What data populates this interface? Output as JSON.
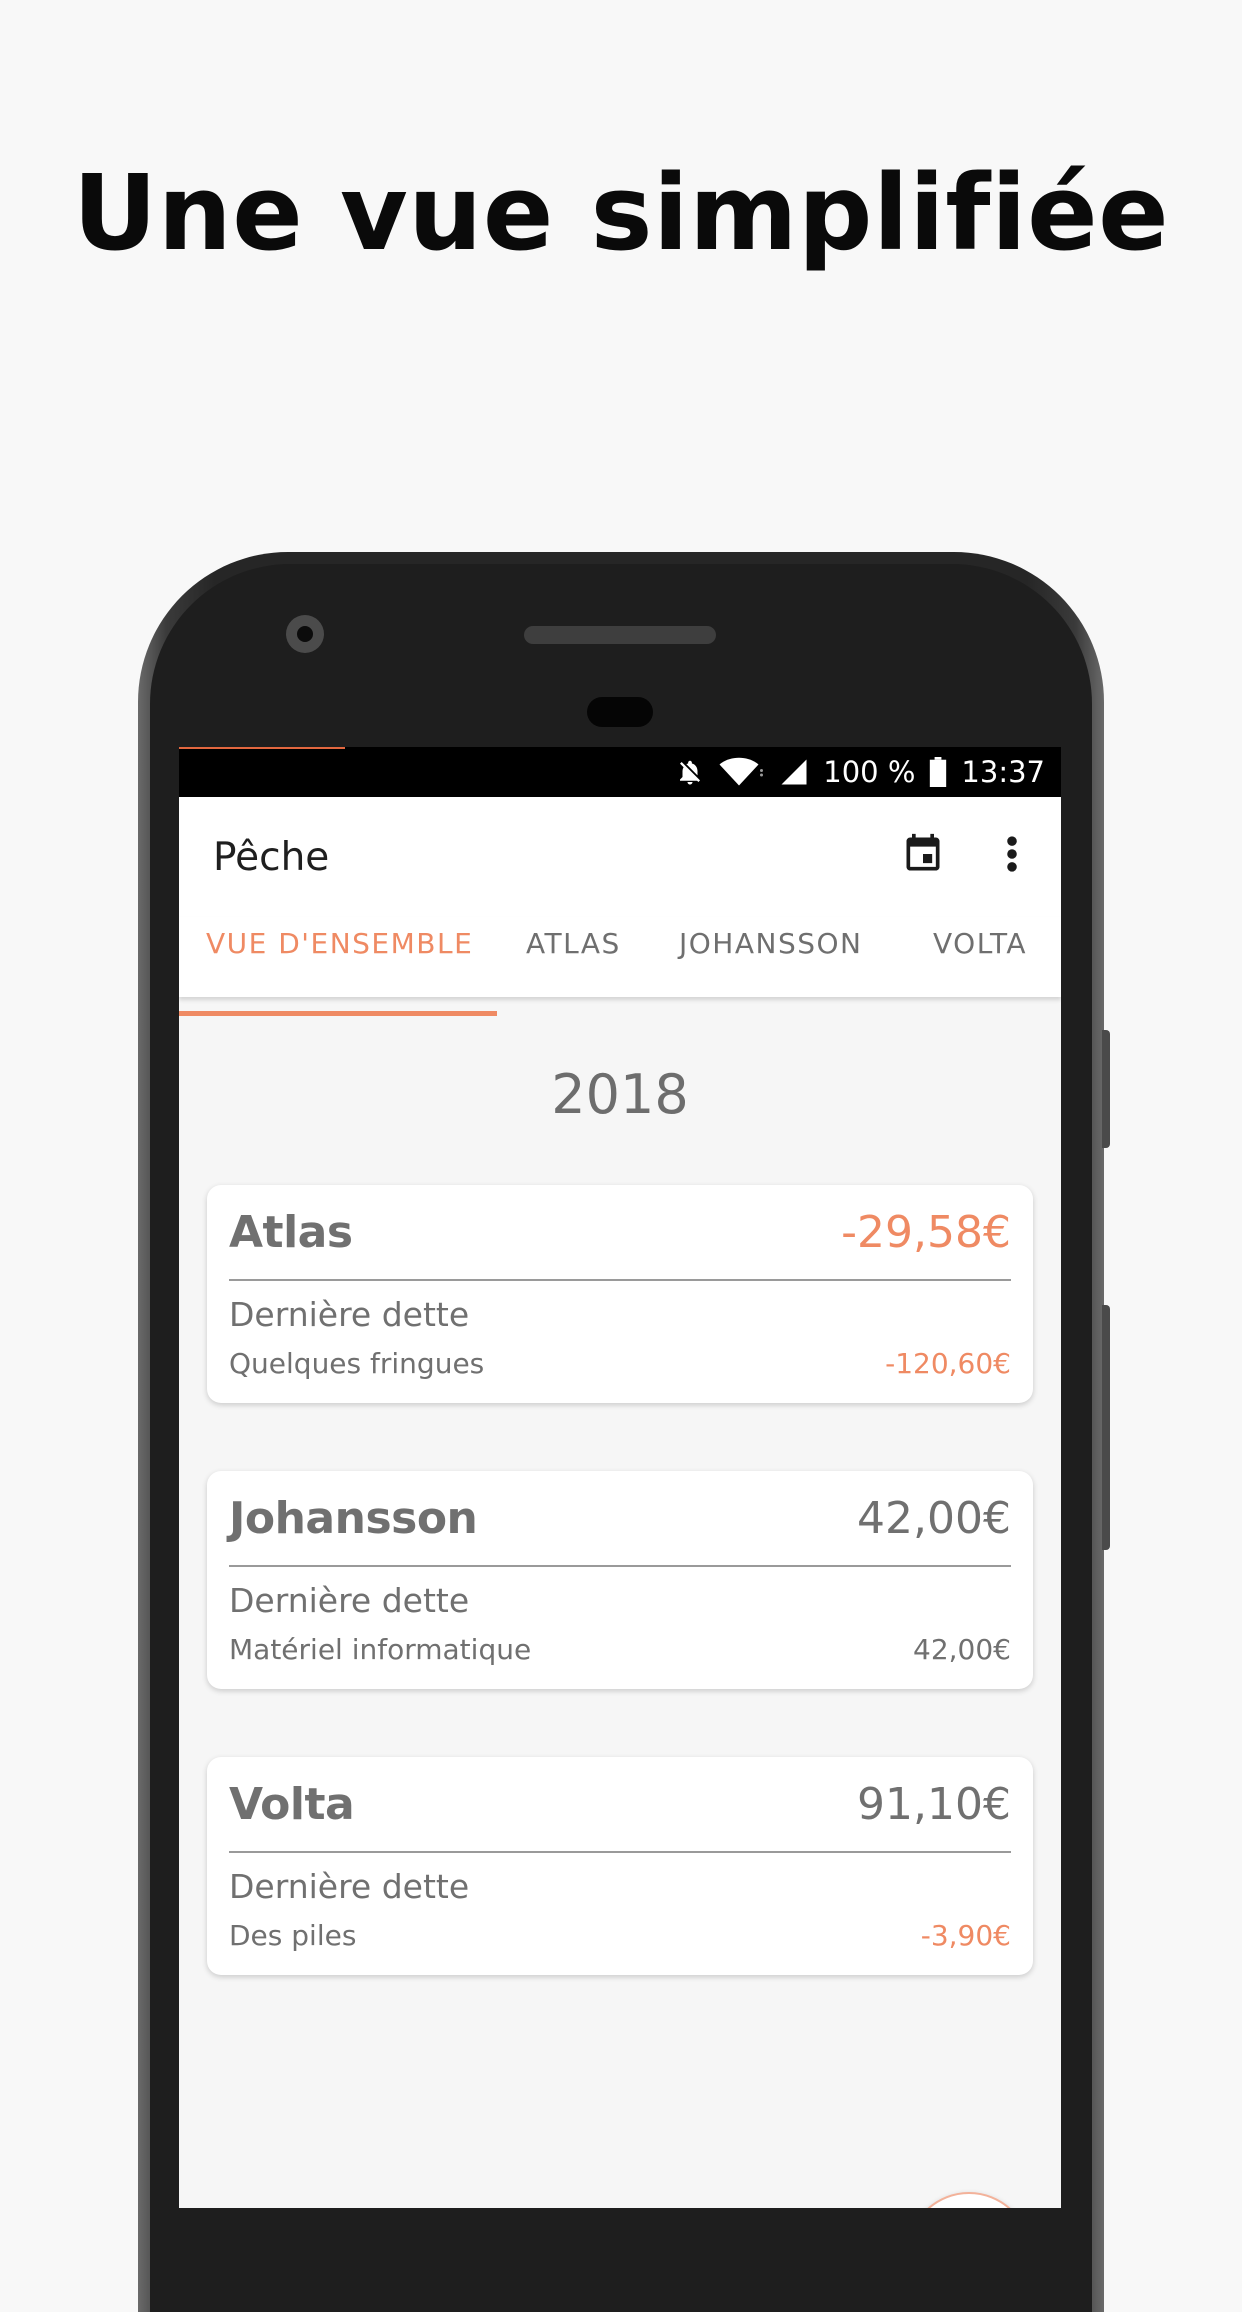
{
  "headline": "Une vue simplifiée",
  "status_bar": {
    "battery": "100 %",
    "time": "13:37",
    "icons": [
      "notifications-off-icon",
      "wifi-icon",
      "signal-icon",
      "battery-icon"
    ]
  },
  "app_bar": {
    "title": "Pêche",
    "actions": [
      "calendar-icon",
      "more-vert-icon"
    ]
  },
  "tabs": [
    {
      "label": "VUE D'ENSEMBLE",
      "active": true
    },
    {
      "label": "ATLAS",
      "active": false
    },
    {
      "label": "JOHANSSON",
      "active": false
    },
    {
      "label": "VOLTA",
      "active": false
    }
  ],
  "year": "2018",
  "cards": [
    {
      "name": "Atlas",
      "total": "-29,58€",
      "label": "Dernière dette",
      "description": "Quelques fringues",
      "amount": "-120,60€"
    },
    {
      "name": "Johansson",
      "total": "42,00€",
      "label": "Dernière dette",
      "description": "Matériel informatique",
      "amount": "42,00€"
    },
    {
      "name": "Volta",
      "total": "91,10€",
      "label": "Dernière dette",
      "description": "Des piles",
      "amount": "-3,90€"
    }
  ],
  "fab": {
    "label": "+"
  },
  "colors": {
    "accent": "#ef8a63",
    "text": "#707070",
    "status_bar": "#000000"
  }
}
